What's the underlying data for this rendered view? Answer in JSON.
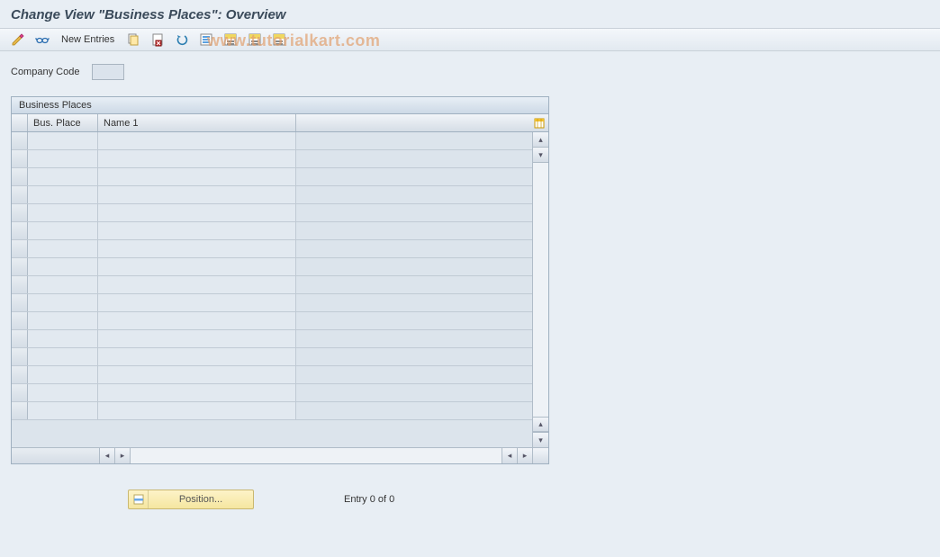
{
  "title": "Change View \"Business Places\": Overview",
  "watermark": "www.tutorialkart.com",
  "toolbar": {
    "new_entries_label": "New Entries",
    "icons": {
      "toggle": "toggle-change-display-icon",
      "glasses": "display-icon",
      "copy": "copy-icon",
      "delete": "delete-icon",
      "undo": "undo-icon",
      "select_all": "select-all-icon",
      "select_block": "select-block-icon",
      "deselect": "deselect-all-icon",
      "print": "print-icon"
    }
  },
  "field": {
    "label": "Company Code",
    "value": ""
  },
  "grid": {
    "title": "Business Places",
    "columns": {
      "bus_place": "Bus. Place",
      "name1": "Name 1"
    },
    "row_count": 16,
    "rows": []
  },
  "footer": {
    "position_label": "Position...",
    "entry_text": "Entry 0 of 0"
  }
}
